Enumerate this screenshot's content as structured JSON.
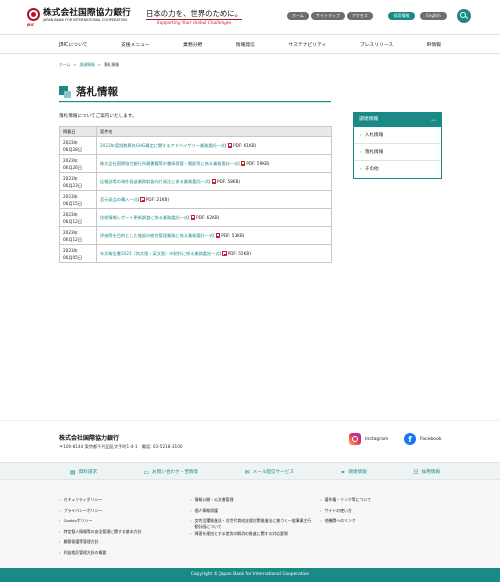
{
  "header": {
    "logo_name": "株式会社国際協力銀行",
    "logo_abbr": "JBIC",
    "logo_en": "JAPAN BANK FOR INTERNATIONAL COOPERATION",
    "slogan_jp": "日本の力を、世界のために。",
    "slogan_en": "Supporting Your Global Challenges",
    "top_links": [
      "ホーム",
      "サイトマップ",
      "アクセス"
    ],
    "recruit_label": "採用情報",
    "english_label": "English",
    "colors": {
      "brand": "#1a8a86",
      "logo_red": "#b0142d"
    }
  },
  "gnav": {
    "items": [
      "JBICについて",
      "支援メニュー",
      "業務分野",
      "情報発信",
      "サステナビリティ",
      "プレスリリース",
      "IR情報"
    ]
  },
  "breadcrumb": {
    "home": "ホーム",
    "parent": "調達情報",
    "current": "落札情報",
    "sep": ">"
  },
  "page": {
    "title": "落札情報",
    "intro": "落札情報についてご案内いたします。"
  },
  "table": {
    "headers": [
      "掲載日",
      "案件名"
    ],
    "rows": [
      {
        "date1": "2023年",
        "date2": "06月28日",
        "title": "2023年度指数異先GHG算定に関するアドバイザリー業務委託一式",
        "file": "PDF: 61KB"
      },
      {
        "date1": "2023年",
        "date2": "06月26日",
        "title": "株式会社国際協力銀行所蔵書籍等の書庫保管・搬配等に係る業務委託一式",
        "file": "PDF: 59KB"
      },
      {
        "date1": "2023年",
        "date2": "06月23日",
        "title": "広報誌等の海外発送業務取扱向け発注に係る業務委託一式",
        "file": "PDF: 58KB"
      },
      {
        "date1": "2023年",
        "date2": "06月15日",
        "title": "宮元発品の購入一式",
        "file": "PDF: 21KB"
      },
      {
        "date1": "2023年",
        "date2": "06月12日",
        "title": "技術情報レポート更新調査に係る業務委託一式",
        "file": "PDF: 62KB"
      },
      {
        "date1": "2023年",
        "date2": "06月12日",
        "title": "評価等を目的とした施設の総合管理業務に係る業務委託一式",
        "file": "PDF: 53KB"
      },
      {
        "date1": "2023年",
        "date2": "06月05日",
        "title": "年次報告書2023（和文版・英文版）の制作に係る業務委託一式",
        "file": "PDF: 55KB"
      }
    ]
  },
  "sidebox": {
    "title": "調達情報",
    "items": [
      "入札情報",
      "落札情報",
      "その他"
    ]
  },
  "footer": {
    "org": "株式会社国際協力銀行",
    "address": "〒100-8144 東京都千代田区大手町1-4-1　電話: 03-5218-3100",
    "instagram": "Instagram",
    "facebook": "Facebook",
    "links": [
      "資料請求",
      "お問い合わせ・苦情等",
      "メール配信サービス",
      "調達情報",
      "採用情報"
    ],
    "col1": [
      "セキュリティポリシー",
      "プライバシーポリシー",
      "Cookieポリシー",
      "特定個人情報等の安全管理に関する基本方針",
      "顧客保護等管理方針",
      "利益相反管理方針の概要"
    ],
    "col2": [
      "情報公開・公文書管理",
      "個人情報保護",
      "女性活躍推進法・次世代育成支援対策推進法に基づく一般事業主行動計画について",
      "障害を理由とする差別の解消の推進に関する対応要領"
    ],
    "col3": [
      "著作権・リンク等について",
      "サイトの使い方",
      "他機関へのリンク"
    ],
    "copyright": "Copyright © Japan Bank for International Cooperation"
  }
}
